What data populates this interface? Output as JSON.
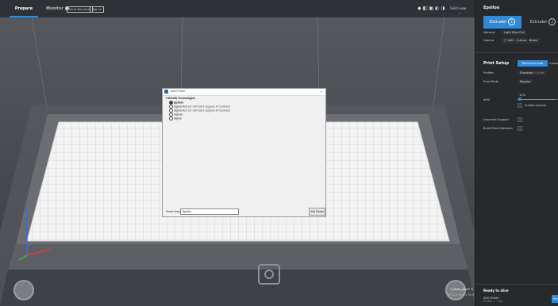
{
  "topbar": {
    "tabs": [
      "Prepare",
      "Monitor"
    ],
    "buttons": [
      "Go to the cloud",
      "Sign in"
    ],
    "view_mode": "Solid view",
    "view_mode_arrow": "⌄"
  },
  "right_panel": {
    "title": "Epsilon",
    "extruders": [
      {
        "label": "Extruder",
        "num": "1"
      },
      {
        "label": "Extruder",
        "num": "2"
      }
    ],
    "material_label": "Material",
    "material_value": "Light Blue PLA",
    "hotend_label": "Hotend",
    "hotend_value": "e3D - 0.4mm - Brass",
    "print_setup_title": "Print Setup",
    "print_setup_tabs": [
      "Recommended",
      "Custom"
    ],
    "profiles_label": "Profiles",
    "profiles_value": "Standard",
    "profiles_suffix": "0.2mm",
    "print_mode_label": "Print Mode",
    "print_mode_value": "Regular",
    "infill_label": "Infill",
    "infill_value": "10%",
    "gradual_label": "Enable gradual",
    "support_label": "Generate Support",
    "adhesion_label": "Build Plate Adhesion",
    "ready_label": "Ready to slice",
    "time_value": "000 00min",
    "material_usage": "0.00m / ~ 0g",
    "print_button": "Pre"
  },
  "object": {
    "name": "3_Nest_part2",
    "dims": "153.2 x 16.8 x 30.0 mm"
  },
  "dialog": {
    "title": "Add Printer",
    "close_glyph": "×",
    "brand": "BCN3D Technologies",
    "group": "Epsilon",
    "items": [
      {
        "name": "Sigma R19",
        "note": "(Or with IDEX upgrade kit installed)",
        "selected": false
      },
      {
        "name": "Sigma R17",
        "note": "(Or with IDEX upgrade kit installed)",
        "selected": false
      },
      {
        "name": "Sigmax",
        "note": "",
        "selected": false
      },
      {
        "name": "Sigma",
        "note": "",
        "selected": false
      }
    ],
    "name_label": "Printer Name",
    "name_value": "Epsilon",
    "add_button": "Add Printer"
  },
  "colors": {
    "accent": "#2f8ad8",
    "panel_bg": "#27292d",
    "plate": "#f2f2f2",
    "axis_x": "#e03a3a",
    "axis_z": "#3a6ce0"
  }
}
